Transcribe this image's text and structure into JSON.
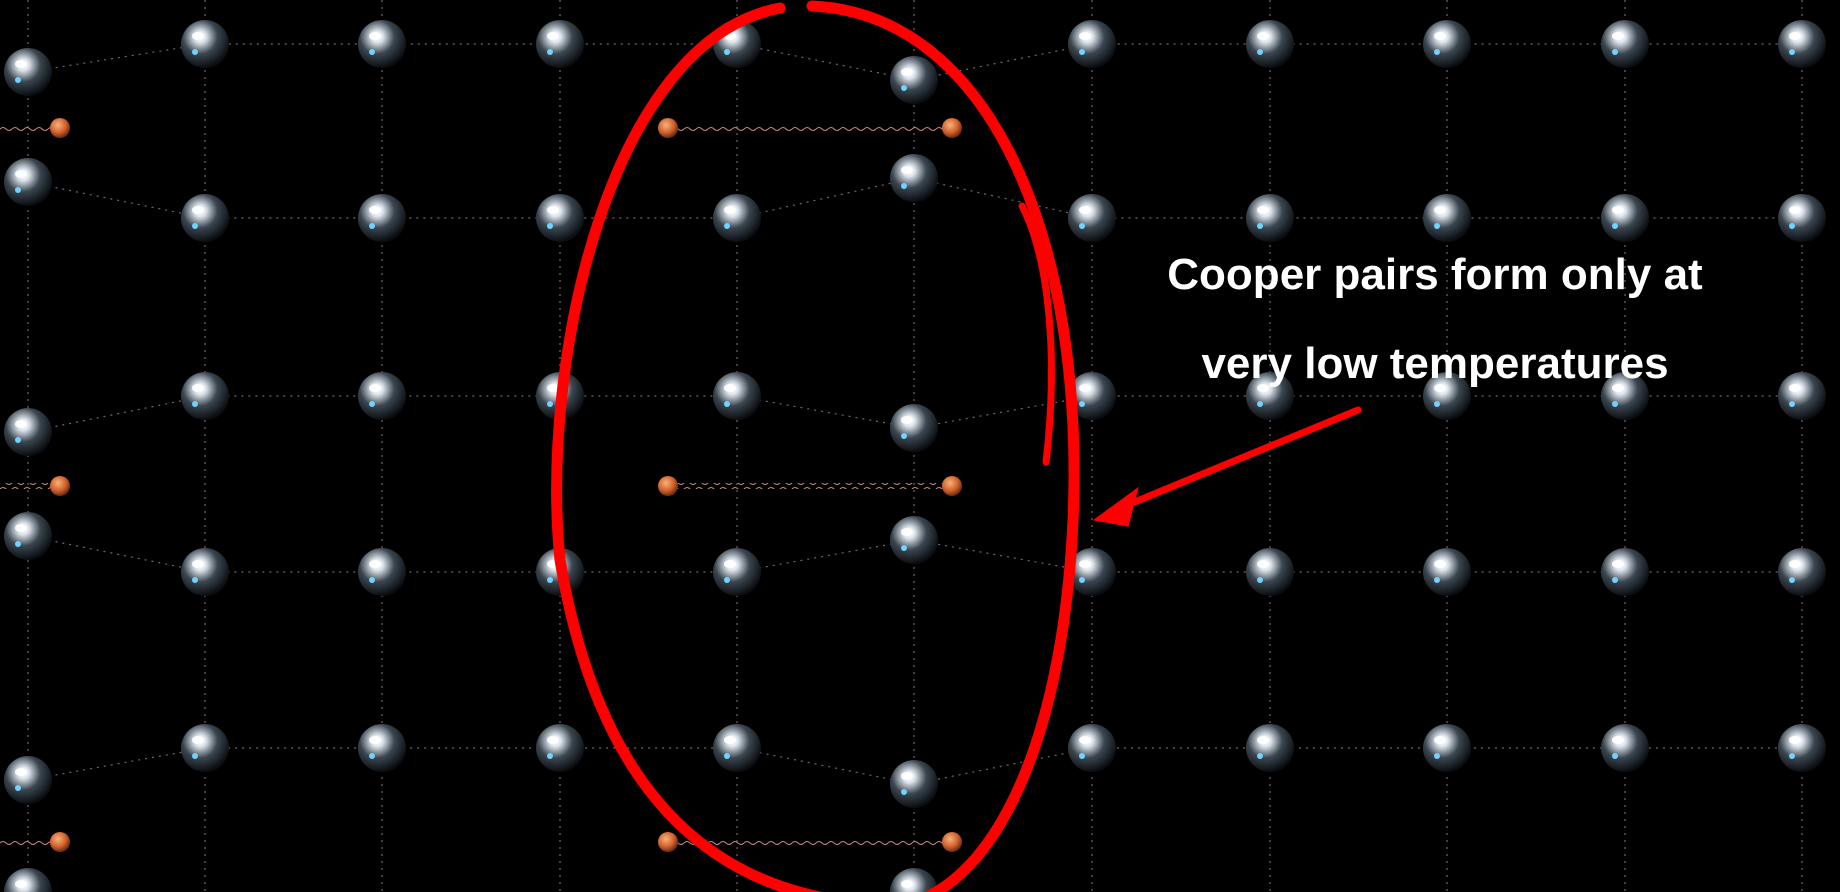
{
  "annotation": {
    "line1": "Cooper pairs form only at",
    "line2": "very low temperatures"
  },
  "colors": {
    "background": "#000000",
    "ink": "#ff0000",
    "ion": "#dfe6ee",
    "electron": "#d2622e",
    "caption": "#ffffff"
  },
  "scene": {
    "subject": "superconductor-lattice-with-cooper-pairs",
    "highlight": "red-ellipse-around-central-pairs",
    "pointer": "red-arrow-toward-ellipse"
  }
}
